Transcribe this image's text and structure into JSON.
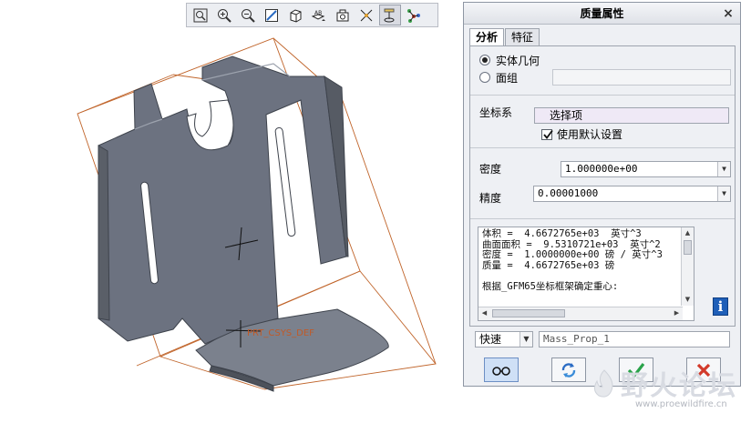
{
  "dialog": {
    "title": "质量属性",
    "close_label": "×",
    "tabs": [
      {
        "label": "分析",
        "active": true
      },
      {
        "label": "特征",
        "active": false
      }
    ],
    "geometry": {
      "solid_label": "实体几何",
      "solid_checked": true,
      "quilt_label": "面组",
      "quilt_checked": false,
      "quilt_value": ""
    },
    "csys": {
      "label": "坐标系",
      "select_value": "选择项",
      "default_checkbox_label": "使用默认设置",
      "default_checked": true
    },
    "density": {
      "label": "密度",
      "value": "1.000000e+00"
    },
    "precision": {
      "label": "精度",
      "value": "0.00001000"
    },
    "results": {
      "lines": [
        "体积 =  4.6672765e+03  英寸^3",
        "曲面面积 =  9.5310721e+03  英寸^2",
        "密度 =  1.0000000e+00 磅 / 英寸^3",
        "质量 =  4.6672765e+03 磅",
        "",
        "根据_GFM65坐标框架确定重心:"
      ]
    },
    "mode": {
      "value": "快速"
    },
    "name_field": {
      "value": "Mass_Prop_1"
    },
    "buttons": [
      "preview",
      "repeat",
      "ok",
      "cancel"
    ]
  },
  "viewport": {
    "csys_label": "PRT_CSYS_DEF",
    "toolbar_icons": [
      "zoom-fit-icon",
      "zoom-in-icon",
      "zoom-out-icon",
      "repaint-icon",
      "display-style-icon",
      "saved-views-icon",
      "layers-icon",
      "datum-display-icon",
      "spin-center-icon",
      "csys-display-icon"
    ]
  },
  "watermark": {
    "title": "野火论坛",
    "url": "www.proewildfire.cn"
  },
  "colors": {
    "model_fill": "#6c7280",
    "model_edge": "#3e434c",
    "bbox_line": "#c0642a",
    "dialog_bg": "#eef0f4",
    "accent_blue": "#1f5fb8",
    "ok_green": "#2aa34a",
    "cancel_red": "#d23a2a"
  }
}
